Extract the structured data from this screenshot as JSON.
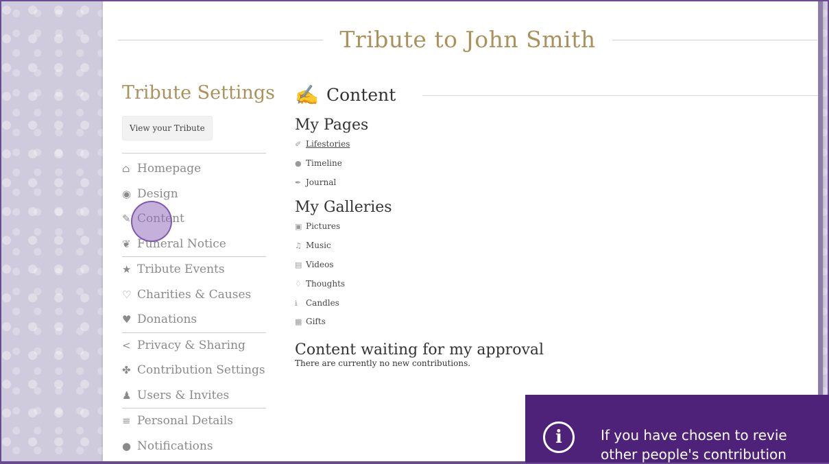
{
  "title": "Tribute to John Smith",
  "sidebar": {
    "heading": "Tribute Settings",
    "view_button": "View your Tribute",
    "groups": [
      [
        {
          "icon": "home-icon",
          "glyph": "⌂",
          "label": "Homepage"
        },
        {
          "icon": "palette-icon",
          "glyph": "◉",
          "label": "Design"
        },
        {
          "icon": "edit-icon",
          "glyph": "✎",
          "label": "Content"
        },
        {
          "icon": "dove-icon",
          "glyph": "❦",
          "label": "Funeral Notice"
        }
      ],
      [
        {
          "icon": "star-icon",
          "glyph": "★",
          "label": "Tribute Events"
        },
        {
          "icon": "ribbon-icon",
          "glyph": "♡",
          "label": "Charities & Causes"
        },
        {
          "icon": "heart-icon",
          "glyph": "♥",
          "label": "Donations"
        }
      ],
      [
        {
          "icon": "share-icon",
          "glyph": "<",
          "label": "Privacy & Sharing"
        },
        {
          "icon": "contribution-icon",
          "glyph": "✤",
          "label": "Contribution Settings"
        },
        {
          "icon": "users-icon",
          "glyph": "♟",
          "label": "Users & Invites"
        }
      ],
      [
        {
          "icon": "list-icon",
          "glyph": "≡",
          "label": "Personal Details"
        },
        {
          "icon": "bell-icon",
          "glyph": "●",
          "label": "Notifications"
        }
      ]
    ]
  },
  "main": {
    "heading": "Content",
    "my_pages": {
      "title": "My Pages",
      "items": [
        {
          "icon": "feather-icon",
          "glyph": "✐",
          "label": "Lifestories",
          "underlined": true
        },
        {
          "icon": "clock-icon",
          "glyph": "●",
          "label": "Timeline",
          "underlined": false
        },
        {
          "icon": "quill-icon",
          "glyph": "✒",
          "label": "Journal",
          "underlined": false
        }
      ]
    },
    "my_galleries": {
      "title": "My Galleries",
      "items": [
        {
          "icon": "picture-icon",
          "glyph": "▣",
          "label": "Pictures"
        },
        {
          "icon": "music-icon",
          "glyph": "♫",
          "label": "Music"
        },
        {
          "icon": "video-icon",
          "glyph": "▤",
          "label": "Videos"
        },
        {
          "icon": "thought-icon",
          "glyph": "♢",
          "label": "Thoughts"
        },
        {
          "icon": "candle-icon",
          "glyph": "ɨ",
          "label": "Candles"
        },
        {
          "icon": "gift-icon",
          "glyph": "▦",
          "label": "Gifts"
        }
      ]
    },
    "pending": {
      "title": "Content waiting for my approval",
      "text": "There are currently no new contributions."
    }
  },
  "callout": {
    "icon": "info-icon",
    "line1": "If you have chosen to revie",
    "line2": "other people's contribution"
  },
  "colors": {
    "accent_gold": "#a9925c",
    "callout_bg": "#4f2279",
    "frame": "#6b4a93"
  }
}
